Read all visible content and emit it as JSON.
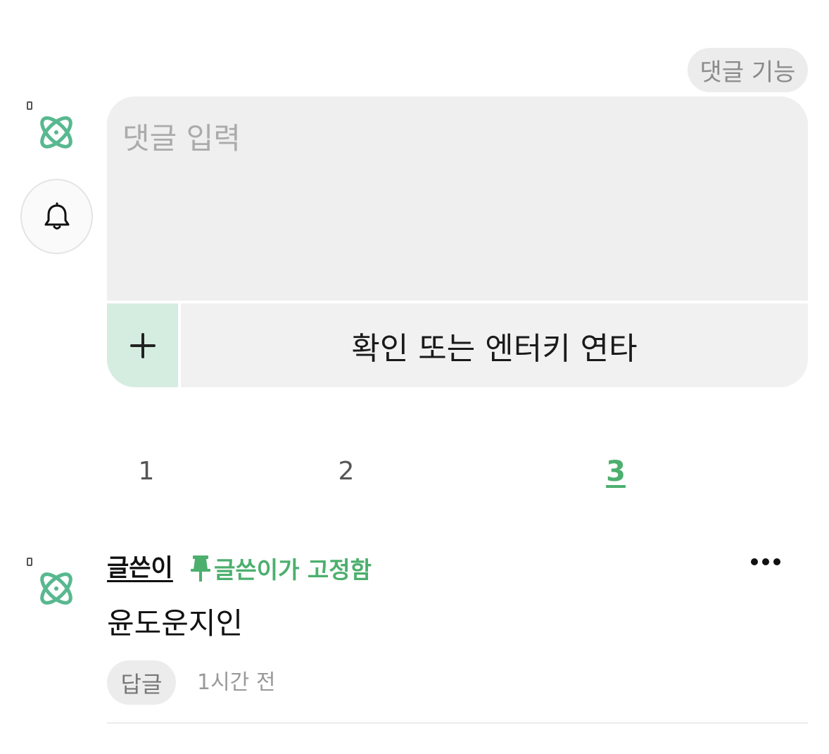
{
  "header": {
    "feature_label": "댓글 기능"
  },
  "composer": {
    "placeholder": "댓글 입력",
    "value": "",
    "submit_label": "확인 또는 엔터키 연타"
  },
  "pagination": {
    "pages": [
      "1",
      "2",
      "3"
    ],
    "current": "3"
  },
  "comment": {
    "author": "글쓴이",
    "pin_label": "글쓴이가 고정함",
    "body": "윤도운지인",
    "reply_label": "답글",
    "time": "1시간 전"
  },
  "colors": {
    "accent": "#4caf6e",
    "avatar": "#58b88f",
    "attach_bg": "#d5ede0",
    "input_bg": "#efefef",
    "pill_bg": "#ececec"
  },
  "icons": {
    "avatar": "atom-icon",
    "notify": "bell-icon",
    "attach": "plus-icon",
    "pin": "pushpin-icon",
    "menu": "more-dots-icon"
  }
}
